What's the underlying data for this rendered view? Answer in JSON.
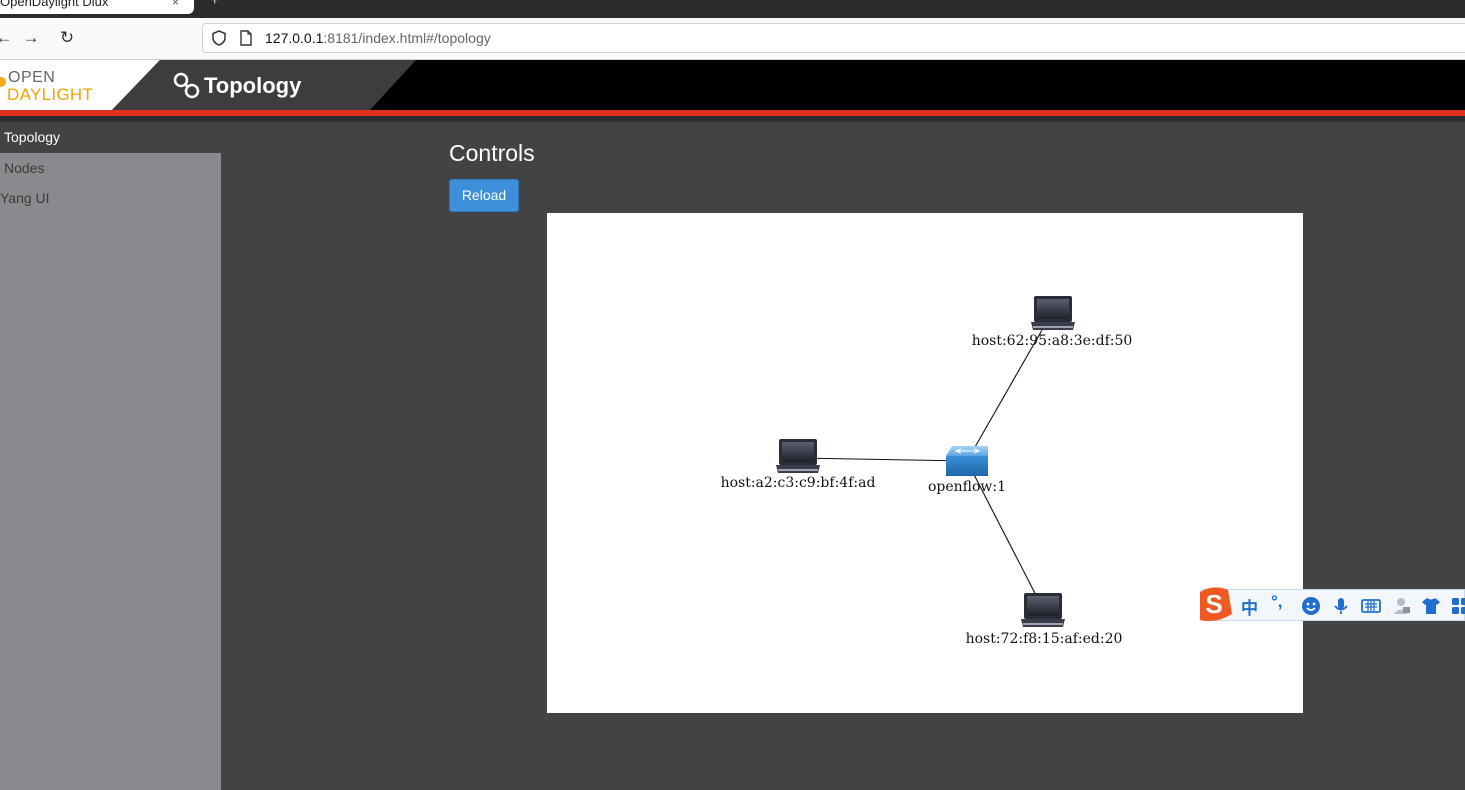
{
  "browser": {
    "tab_title": "OpenDaylight Dlux",
    "tab_close": "×",
    "new_tab": "+",
    "back": "←",
    "forward": "→",
    "reload": "↻",
    "url_host": "127.0.0.1",
    "url_rest": ":8181/index.html#/topology"
  },
  "header": {
    "logo_open": "OPEN",
    "logo_daylight": "DAYLIGHT",
    "title": "Topology"
  },
  "sidebar": {
    "items": [
      {
        "label": "Topology"
      },
      {
        "label": "Nodes"
      },
      {
        "label": "Yang UI"
      }
    ]
  },
  "main": {
    "controls_title": "Controls",
    "reload_label": "Reload"
  },
  "topology": {
    "nodes": [
      {
        "id": "switch",
        "kind": "switch",
        "label": "openflow:1"
      },
      {
        "id": "h1",
        "kind": "host",
        "label": "host:62:95:a8:3e:df:50"
      },
      {
        "id": "h2",
        "kind": "host",
        "label": "host:a2:c3:c9:bf:4f:ad"
      },
      {
        "id": "h3",
        "kind": "host",
        "label": "host:72:f8:15:af:ed:20"
      }
    ],
    "links": [
      [
        "switch",
        "h1"
      ],
      [
        "switch",
        "h2"
      ],
      [
        "switch",
        "h3"
      ]
    ]
  },
  "ime": {
    "chinese": "中",
    "punct": "°,"
  }
}
